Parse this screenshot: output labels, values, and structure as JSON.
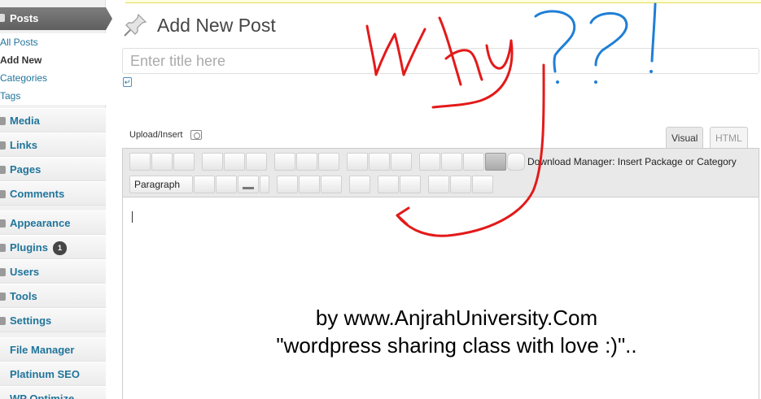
{
  "sidebar": {
    "posts_label": "Posts",
    "submenu": [
      "All Posts",
      "Add New",
      "Categories",
      "Tags"
    ],
    "items": [
      {
        "label": "Media",
        "icon": "media-icon"
      },
      {
        "label": "Links",
        "icon": "links-icon"
      },
      {
        "label": "Pages",
        "icon": "pages-icon"
      },
      {
        "label": "Comments",
        "icon": "comments-icon"
      },
      {
        "label": "Appearance",
        "icon": "appearance-icon"
      },
      {
        "label": "Plugins",
        "icon": "plugins-icon",
        "badge": "1"
      },
      {
        "label": "Users",
        "icon": "users-icon"
      },
      {
        "label": "Tools",
        "icon": "tools-icon"
      },
      {
        "label": "Settings",
        "icon": "settings-icon"
      },
      {
        "label": "File Manager"
      },
      {
        "label": "Platinum SEO"
      },
      {
        "label": "WP Optimize"
      }
    ]
  },
  "main": {
    "page_title": "Add New Post",
    "title_placeholder": "Enter title here",
    "upload_insert": "Upload/Insert",
    "tabs": [
      "Visual",
      "HTML"
    ],
    "download_manager": "Download Manager: Insert Package or Category",
    "paragraph_select": "Paragraph",
    "credit_line1": "by www.AnjrahUniversity.Com",
    "credit_line2": "\"wordpress sharing class with love :)\".."
  },
  "annotation": {
    "text": "Why??!",
    "colors": {
      "red": "#e31a1a",
      "blue": "#1f7fd6"
    }
  }
}
